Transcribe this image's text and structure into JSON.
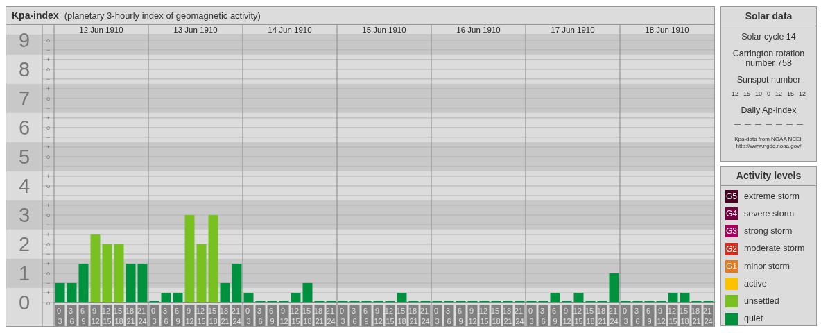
{
  "title": {
    "name": "Kpa-index",
    "subtitle": "(planetary 3-hourly index of geomagnetic activity)"
  },
  "days": [
    "12 Jun 1910",
    "13 Jun 1910",
    "14 Jun 1910",
    "15 Jun 1910",
    "16 Jun 1910",
    "17 Jun 1910",
    "18 Jun 1910"
  ],
  "scale_marks": [
    "o",
    "−",
    "+",
    "o",
    "−",
    "+",
    "o",
    "−",
    "+",
    "o",
    "−",
    "+",
    "o",
    "−",
    "+",
    "o",
    "−",
    "+",
    "o",
    "−",
    "+",
    "o",
    "−",
    "+",
    "o",
    "−",
    "+",
    "o"
  ],
  "chart_data": {
    "type": "bar",
    "grid": true,
    "ylim": [
      0,
      9.52
    ],
    "bands": [
      {
        "axis": "y",
        "from": 0.5,
        "to": 1.5
      },
      {
        "axis": "y",
        "from": 2.5,
        "to": 3.5
      },
      {
        "axis": "y",
        "from": 4.5,
        "to": 5.5
      },
      {
        "axis": "y",
        "from": 6.5,
        "to": 7.5
      },
      {
        "axis": "y",
        "from": 8.5,
        "to": 9.19
      }
    ],
    "categories": [
      "0 3",
      "3 6",
      "6 9",
      "9 12",
      "12 15",
      "15 18",
      "18 21",
      "21 24",
      "0 3",
      "3 6",
      "6 9",
      "9 12",
      "12 15",
      "15 18",
      "18 21",
      "21 24",
      "0 3",
      "3 6",
      "6 9",
      "9 12",
      "12 15",
      "15 18",
      "18 21",
      "21 24",
      "0 3",
      "3 6",
      "6 9",
      "9 12",
      "12 15",
      "15 18",
      "18 21",
      "21 24",
      "0 3",
      "3 6",
      "6 9",
      "9 12",
      "12 15",
      "15 18",
      "18 21",
      "21 24",
      "0 3",
      "3 6",
      "6 9",
      "9 12",
      "12 15",
      "15 18",
      "18 21",
      "21 24",
      "0 3",
      "3 6",
      "6 9",
      "9 12",
      "12 15",
      "15 18",
      "18 21",
      "21 24"
    ],
    "yticks": [
      {
        "value": 0,
        "label": "0"
      },
      {
        "value": 1,
        "label": "1"
      },
      {
        "value": 2,
        "label": "2"
      },
      {
        "value": 3,
        "label": "3"
      },
      {
        "value": 4,
        "label": "4"
      },
      {
        "value": 5,
        "label": "5"
      },
      {
        "value": 6,
        "label": "6"
      },
      {
        "value": 7,
        "label": "7"
      },
      {
        "value": 8,
        "label": "8"
      },
      {
        "value": 9,
        "label": "9"
      }
    ],
    "series": [
      {
        "color": "#00913f",
        "values": [
          0.67,
          0.67,
          1.33,
          null,
          null,
          null,
          1.33,
          1.33,
          0,
          0.33,
          0.33,
          null,
          null,
          null,
          0.67,
          1.33,
          0.33,
          0,
          0,
          0,
          0.33,
          0.67,
          0,
          0,
          0,
          0,
          0,
          0,
          0,
          0.33,
          0,
          0,
          0,
          0,
          0,
          0,
          0,
          0,
          0,
          0,
          0,
          0,
          0.33,
          0,
          0.33,
          0,
          0,
          1,
          0,
          0,
          0,
          0,
          0.33,
          0.33,
          0,
          0
        ]
      },
      {
        "color": "#78c121",
        "values": [
          null,
          null,
          null,
          2.33,
          2,
          2,
          null,
          null,
          null,
          null,
          null,
          3,
          2,
          3,
          null,
          null,
          null,
          null,
          null,
          null,
          null,
          null,
          null,
          null,
          null,
          null,
          null,
          null,
          null,
          null,
          null,
          null,
          null,
          null,
          null,
          null,
          null,
          null,
          null,
          null,
          null,
          null,
          null,
          null,
          null,
          null,
          null,
          null,
          null,
          null,
          null,
          null,
          null,
          null,
          null,
          null
        ]
      }
    ]
  },
  "solar_data": {
    "title": "Solar data",
    "cycle": "Solar cycle 14",
    "rotation": "Carrington rotation number 758",
    "sunspot_label": "Sunspot number",
    "sunspots": [
      "12",
      "15",
      "10",
      "0",
      "12",
      "15",
      "12"
    ],
    "ap_label": "Daily Ap-index",
    "ap_values": [
      "—",
      "—",
      "—",
      "—",
      "—",
      "—",
      "—"
    ],
    "note": "Kpa-data from NOAA NCEI:",
    "note_url": "http://www.ngdc.noaa.gov/"
  },
  "activity_levels": {
    "title": "Activity levels",
    "items": [
      {
        "badge": "G5",
        "label": "extreme storm",
        "color": "#4a0023"
      },
      {
        "badge": "G4",
        "label": "severe storm",
        "color": "#780041"
      },
      {
        "badge": "G3",
        "label": "strong storm",
        "color": "#a8005a"
      },
      {
        "badge": "G2",
        "label": "moderate storm",
        "color": "#d82c1c"
      },
      {
        "badge": "G1",
        "label": "minor storm",
        "color": "#e47a1e"
      },
      {
        "label": "active",
        "color": "#fcc200"
      },
      {
        "label": "unsettled",
        "color": "#78c121"
      },
      {
        "label": "quiet",
        "color": "#00913f"
      }
    ]
  }
}
